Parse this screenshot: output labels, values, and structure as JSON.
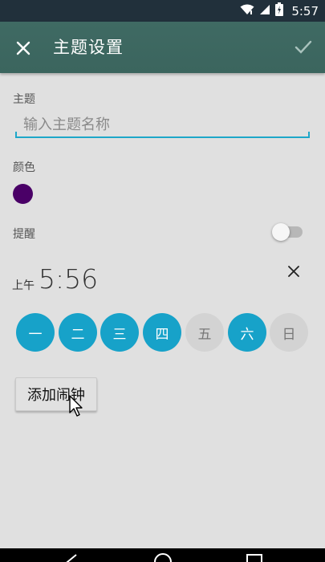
{
  "status_bar": {
    "time": "5:57"
  },
  "app_bar": {
    "title": "主题设置"
  },
  "form": {
    "topic_label": "主题",
    "topic_placeholder": "输入主题名称",
    "topic_value": "",
    "color_label": "颜色",
    "color_value": "#4a0067",
    "reminder_label": "提醒",
    "reminder_enabled": false
  },
  "alarm": {
    "ampm": "上午",
    "time": "5:56",
    "days": [
      {
        "label": "一",
        "selected": true
      },
      {
        "label": "二",
        "selected": true
      },
      {
        "label": "三",
        "selected": true
      },
      {
        "label": "四",
        "selected": true
      },
      {
        "label": "五",
        "selected": false
      },
      {
        "label": "六",
        "selected": true
      },
      {
        "label": "日",
        "selected": false
      }
    ]
  },
  "actions": {
    "add_alarm_label": "添加闹钟"
  },
  "colors": {
    "accent": "#17a2c9",
    "app_bar": "#3f6a63",
    "status_bar": "#21303b",
    "background": "#e0e0e0"
  }
}
